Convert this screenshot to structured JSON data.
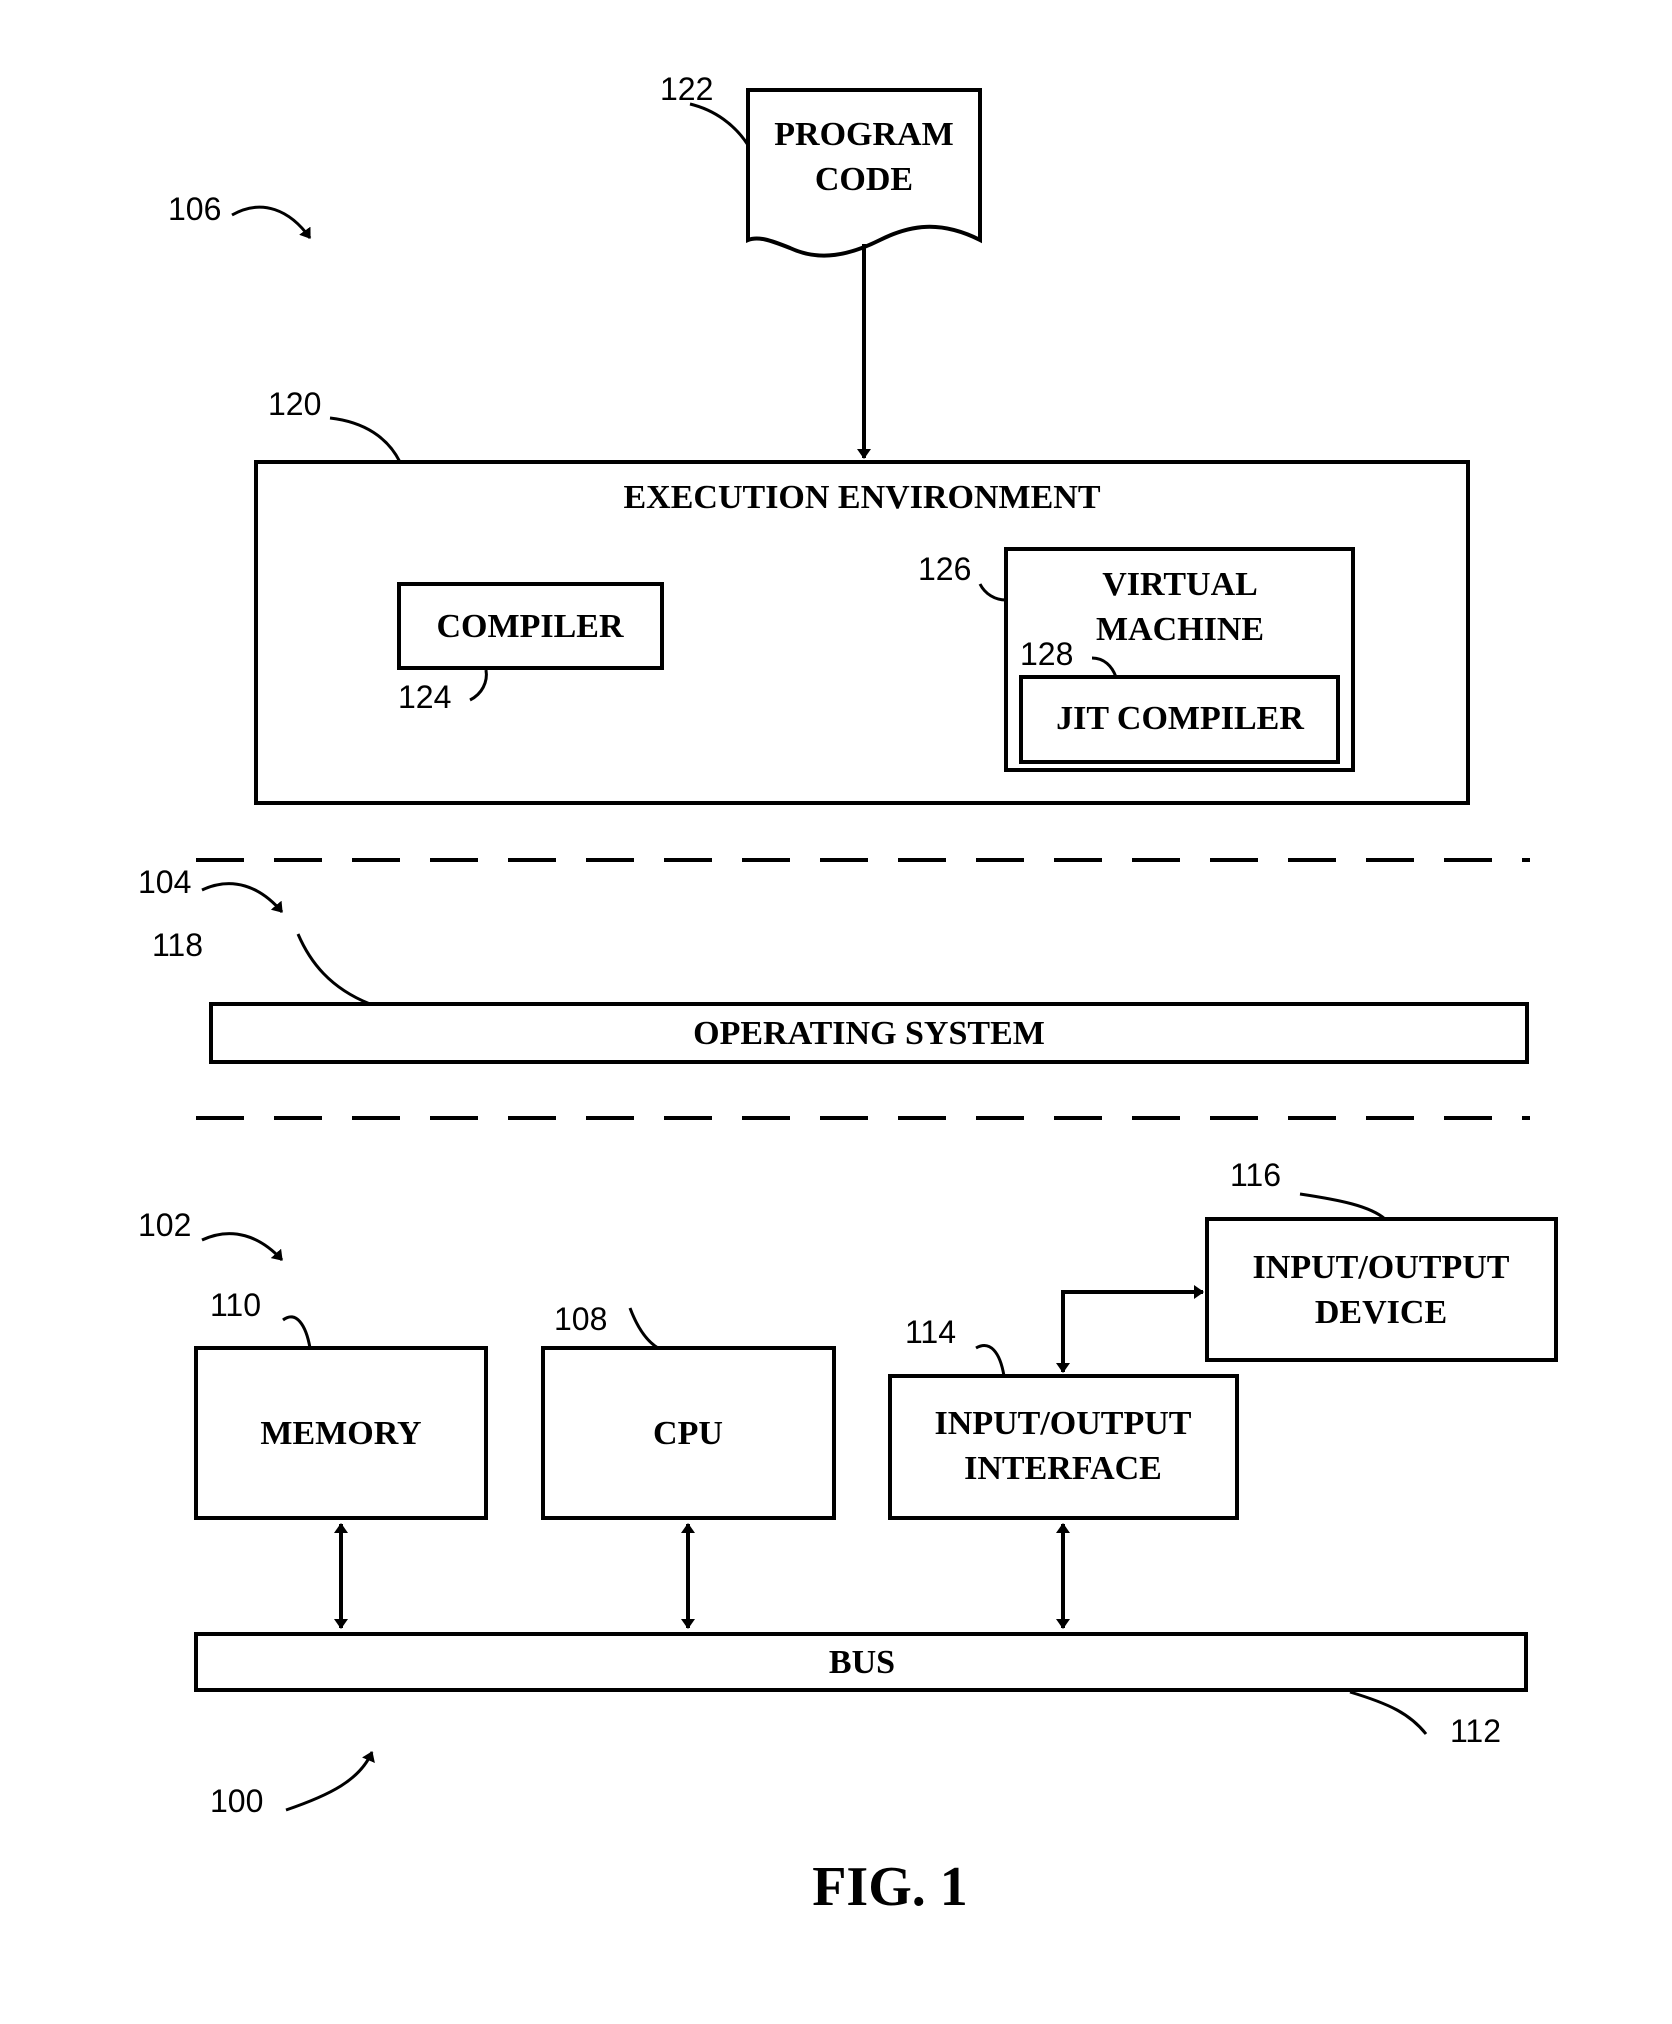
{
  "figure": {
    "caption": "FIG. 1",
    "colors": {
      "ink": "#000000",
      "background": "#ffffff"
    }
  },
  "layers": {
    "software": {
      "ref": "106"
    },
    "os_layer": {
      "ref": "104"
    },
    "hardware": {
      "ref": "102"
    },
    "system": {
      "ref": "100"
    }
  },
  "program_code": {
    "ref": "122",
    "line1": "PROGRAM",
    "line2": "CODE"
  },
  "execution_environment": {
    "ref": "120",
    "label": "EXECUTION ENVIRONMENT"
  },
  "compiler": {
    "ref": "124",
    "label": "COMPILER"
  },
  "virtual_machine": {
    "ref": "126",
    "line1": "VIRTUAL",
    "line2": "MACHINE"
  },
  "jit_compiler": {
    "ref": "128",
    "label": "JIT COMPILER"
  },
  "operating_system": {
    "ref": "118",
    "label": "OPERATING SYSTEM"
  },
  "io_device": {
    "ref": "116",
    "line1": "INPUT/OUTPUT",
    "line2": "DEVICE"
  },
  "memory": {
    "ref": "110",
    "label": "MEMORY"
  },
  "cpu": {
    "ref": "108",
    "label": "CPU"
  },
  "io_interface": {
    "ref": "114",
    "line1": "INPUT/OUTPUT",
    "line2": "INTERFACE"
  },
  "bus": {
    "ref": "112",
    "label": "BUS"
  }
}
